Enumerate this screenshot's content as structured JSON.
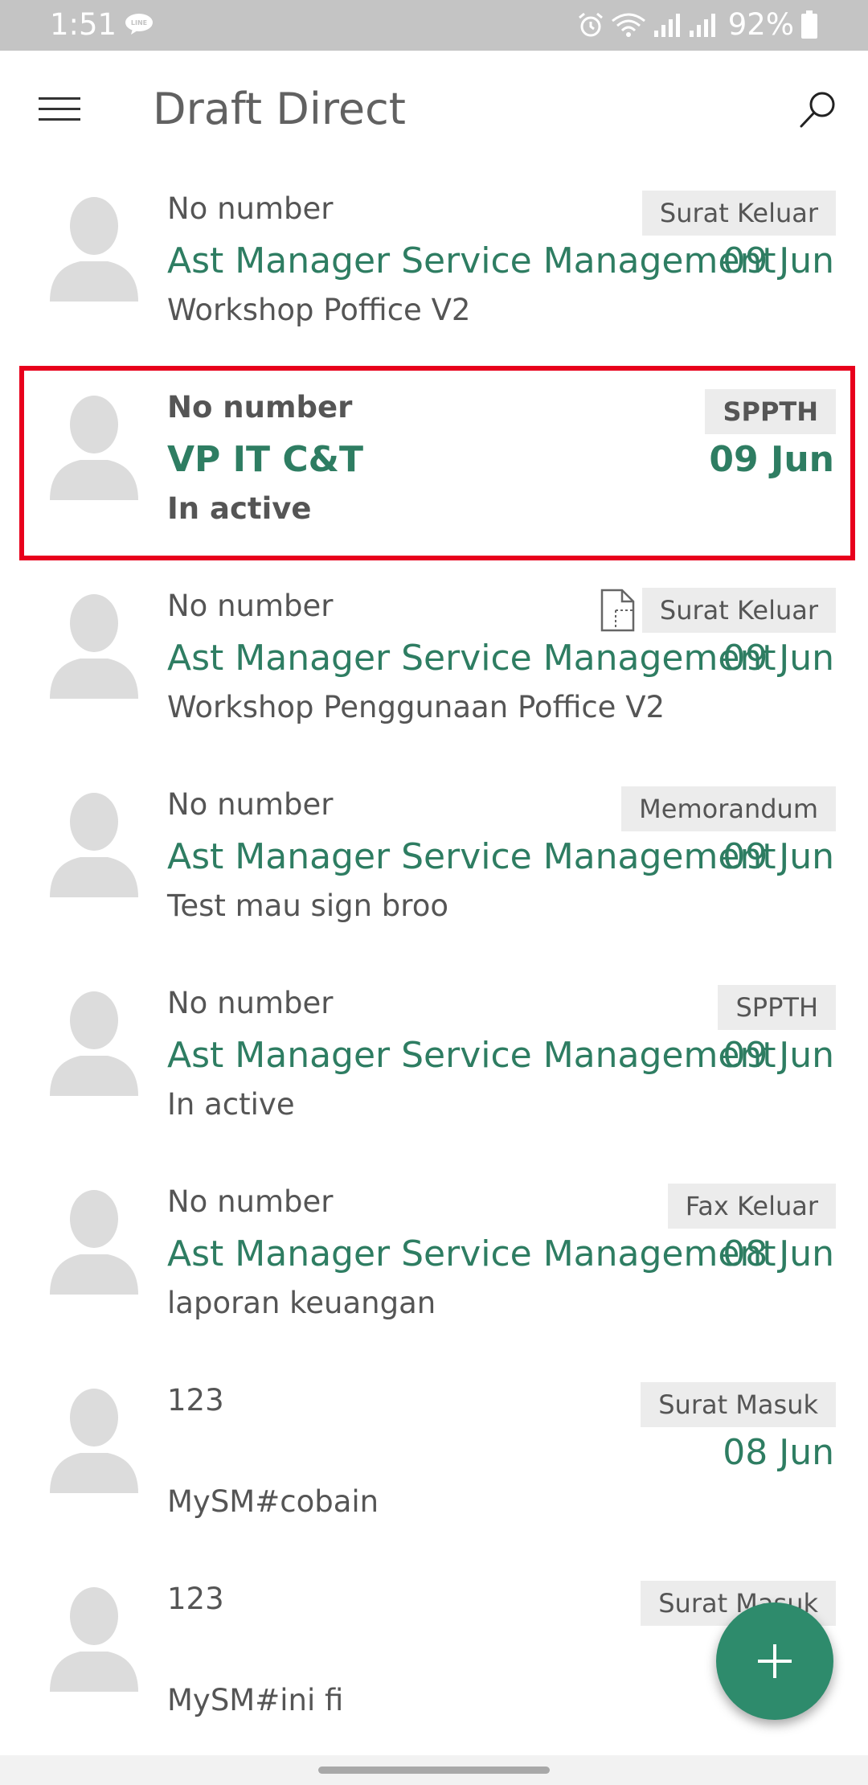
{
  "status_bar": {
    "time": "1:51",
    "battery": "92%",
    "icons": [
      "line-app-icon",
      "alarm-icon",
      "wifi-icon",
      "signal-icon",
      "signal-icon",
      "battery-icon"
    ]
  },
  "app_bar": {
    "title": "Draft Direct",
    "menu_icon": "menu-icon",
    "search_icon": "search-icon"
  },
  "colors": {
    "accent_green": "#2e7d62",
    "fab_green": "#2e8b6c",
    "highlight_red": "#e8001c",
    "status_bar_gray": "#c4c4c4"
  },
  "items": [
    {
      "number": "No number",
      "sender": "Ast Manager Service Management",
      "subject": "Workshop Poffice V2",
      "date": "09 Jun",
      "type": "Surat Keluar"
    },
    {
      "number": "No number",
      "sender": "VP IT C&T",
      "subject": "In active",
      "date": "09 Jun",
      "type": "SPPTH"
    },
    {
      "number": "No number",
      "sender": "Ast Manager Service Management",
      "subject": "Workshop Penggunaan Poffice V2",
      "date": "09 Jun",
      "type": "Surat Keluar"
    },
    {
      "number": "No number",
      "sender": "Ast Manager Service Management",
      "subject": "Test mau sign broo",
      "date": "09 Jun",
      "type": "Memorandum"
    },
    {
      "number": "No number",
      "sender": "Ast Manager Service Management",
      "subject": "In active",
      "date": "09 Jun",
      "type": "SPPTH"
    },
    {
      "number": "No number",
      "sender": "Ast Manager Service Management",
      "subject": "laporan keuangan",
      "date": "08 Jun",
      "type": "Fax Keluar"
    },
    {
      "number": "123",
      "sender": "",
      "subject": "MySM#cobain",
      "date": "08 Jun",
      "type": "Surat Masuk"
    },
    {
      "number": "123",
      "sender": "",
      "subject": "MySM#ini fi",
      "date": "",
      "type": "Surat Masuk"
    }
  ],
  "fab": {
    "icon": "plus-icon"
  }
}
